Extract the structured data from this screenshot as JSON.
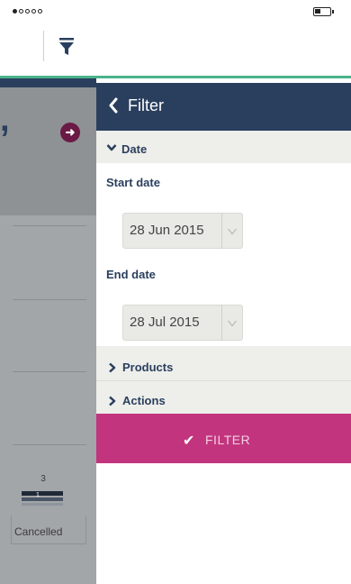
{
  "status_bar": {
    "signal": [
      true,
      false,
      false,
      false,
      false
    ]
  },
  "top_bar": {
    "filter_icon": "funnel-icon"
  },
  "background": {
    "status_count": "3",
    "bar_value": "1",
    "status_label": "Cancelled"
  },
  "filter_panel": {
    "title": "Filter",
    "sections": {
      "date": {
        "label": "Date",
        "start_label": "Start date",
        "start_value": "28 Jun 2015",
        "end_label": "End date",
        "end_value": "28 Jul 2015"
      },
      "products": {
        "label": "Products"
      },
      "actions": {
        "label": "Actions"
      }
    },
    "filter_button": {
      "label": "FILTER"
    }
  },
  "colors": {
    "header": "#2a3f5e",
    "accent_green": "#4bb38a",
    "filter_button": "#c2357e",
    "section_bg": "#eeeeea"
  }
}
